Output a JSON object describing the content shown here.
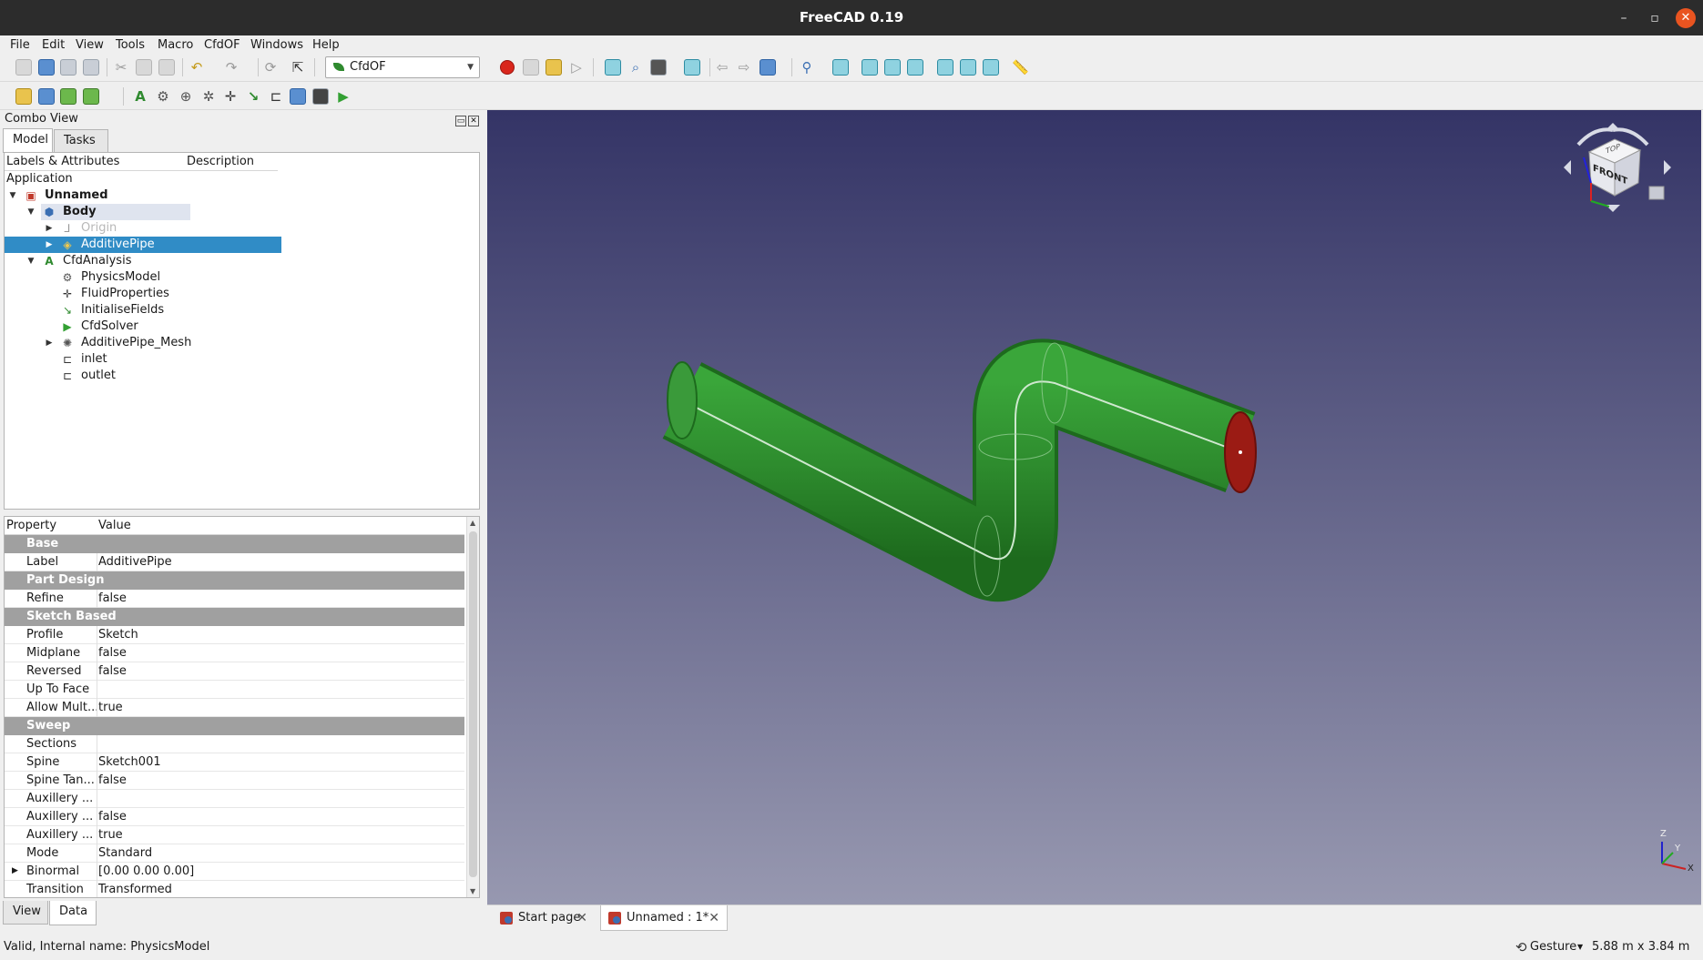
{
  "window": {
    "title": "FreeCAD 0.19",
    "min_glyph": "–",
    "max_glyph": "▫",
    "close_glyph": "✕"
  },
  "menu": [
    "File",
    "Edit",
    "View",
    "Tools",
    "Macro",
    "CfdOF",
    "Windows",
    "Help"
  ],
  "workbench": {
    "selected": "CfdOF"
  },
  "combo_view": {
    "title": "Combo View",
    "tabs": [
      "Model",
      "Tasks"
    ]
  },
  "tree": {
    "col_labels": "Labels & Attributes",
    "col_desc": "Description",
    "root": "Application",
    "items": [
      {
        "label": "Unnamed",
        "icon": "document-icon"
      },
      {
        "label": "Body",
        "icon": "body-icon"
      },
      {
        "label": "Origin",
        "icon": "origin-icon"
      },
      {
        "label": "AdditivePipe",
        "icon": "additive-pipe-icon"
      },
      {
        "label": "CfdAnalysis",
        "icon": "cfd-analysis-icon"
      },
      {
        "label": "PhysicsModel",
        "icon": "physics-model-icon"
      },
      {
        "label": "FluidProperties",
        "icon": "fluid-properties-icon"
      },
      {
        "label": "InitialiseFields",
        "icon": "initialise-fields-icon"
      },
      {
        "label": "CfdSolver",
        "icon": "cfd-solver-icon"
      },
      {
        "label": "AdditivePipe_Mesh",
        "icon": "mesh-icon"
      },
      {
        "label": "inlet",
        "icon": "boundary-icon"
      },
      {
        "label": "outlet",
        "icon": "boundary-icon"
      }
    ]
  },
  "properties": {
    "col_property": "Property",
    "col_value": "Value",
    "groups": {
      "base": "Base",
      "part_design": "Part Design",
      "sketch_based": "Sketch Based",
      "sweep": "Sweep"
    },
    "rows": {
      "label": {
        "k": "Label",
        "v": "AdditivePipe"
      },
      "refine": {
        "k": "Refine",
        "v": "false"
      },
      "profile": {
        "k": "Profile",
        "v": "Sketch"
      },
      "midplane": {
        "k": "Midplane",
        "v": "false"
      },
      "reversed": {
        "k": "Reversed",
        "v": "false"
      },
      "up_to_face": {
        "k": "Up To Face",
        "v": ""
      },
      "allow_mult": {
        "k": "Allow Mult...",
        "v": "true"
      },
      "sections": {
        "k": "Sections",
        "v": ""
      },
      "spine": {
        "k": "Spine",
        "v": "Sketch001"
      },
      "spine_tan": {
        "k": "Spine Tan...",
        "v": "false"
      },
      "aux1": {
        "k": "Auxillery ...",
        "v": ""
      },
      "aux2": {
        "k": "Auxillery ...",
        "v": "false"
      },
      "aux3": {
        "k": "Auxillery ...",
        "v": "true"
      },
      "mode": {
        "k": "Mode",
        "v": "Standard"
      },
      "binormal": {
        "k": "Binormal",
        "v": "[0.00 0.00 0.00]"
      },
      "transition": {
        "k": "Transition",
        "v": "Transformed"
      }
    }
  },
  "bottom_tabs": [
    "View",
    "Data"
  ],
  "doc_tabs": [
    "Start page",
    "Unnamed : 1*"
  ],
  "navcube": {
    "front": "FRONT",
    "top": "TOP"
  },
  "axes": {
    "x": "X",
    "y": "Y",
    "z": "Z"
  },
  "status": {
    "message": "Valid, Internal name: PhysicsModel",
    "nav_style": "Gesture",
    "dimensions": "5.88 m x 3.84 m"
  },
  "colors": {
    "pipe": "#2d8a2d",
    "outlet_face": "#9b1b14",
    "selection": "#308cc6",
    "viewport_top": "#343466",
    "viewport_bottom": "#9798b0"
  }
}
